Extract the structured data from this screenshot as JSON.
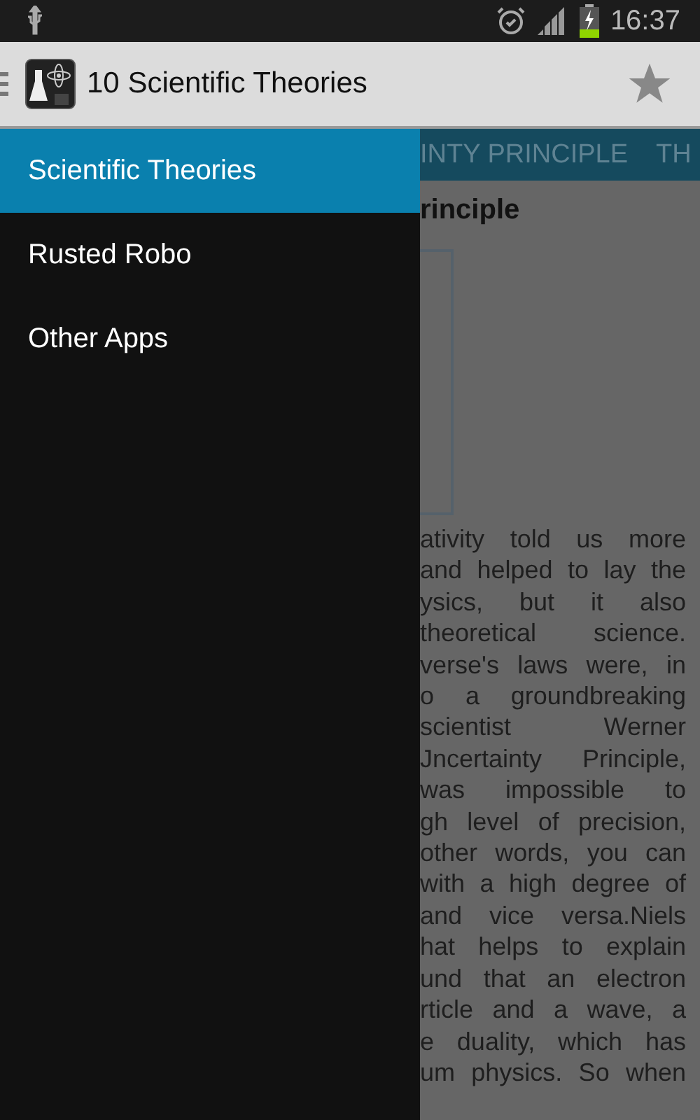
{
  "status_bar": {
    "time": "16:37"
  },
  "action_bar": {
    "title": "10 Scientific Theories"
  },
  "drawer": {
    "items": [
      {
        "label": "Scientific Theories",
        "selected": true
      },
      {
        "label": "Rusted Robo",
        "selected": false
      },
      {
        "label": "Other Apps",
        "selected": false
      }
    ]
  },
  "tabs": [
    "INTY PRINCIPLE",
    "TH"
  ],
  "article": {
    "heading": "rinciple",
    "lines": [
      "ativity told us more",
      "and helped to lay the",
      "ysics, but it also",
      "theoretical science.",
      "verse's laws were, in",
      "o a groundbreaking",
      "scientist Werner",
      "Jncertainty Principle,",
      "was impossible to",
      "gh level of precision,",
      "other words, you can",
      "with a high degree of",
      "and vice versa.Niels",
      "hat helps to explain",
      "und that an electron",
      "rticle and a wave, a",
      "e duality, which has",
      "um physics. So when"
    ]
  }
}
